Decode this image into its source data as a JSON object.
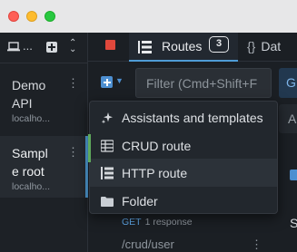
{
  "window": {
    "controls": [
      "close",
      "minimize",
      "zoom"
    ]
  },
  "sidebar": {
    "toolbar": {
      "env_icon": "laptop-icon",
      "ellipsis": "...",
      "add_icon": "plus-icon",
      "collapse_icon": "chevron-double-icon"
    },
    "environments": [
      {
        "name_line1": "Demo",
        "name_line2": "API",
        "host": "localho..."
      },
      {
        "name_line1": "Sampl",
        "name_line2": "e root",
        "host": "localho...",
        "selected": true
      }
    ],
    "kebab": "⋮"
  },
  "tabs": {
    "routes_label": "Routes",
    "routes_count": "3",
    "data_label": "Dat"
  },
  "route_toolbar": {
    "filter_placeholder": "Filter (Cmd+Shift+F",
    "partial_button": "G"
  },
  "add_menu": {
    "items": [
      {
        "label": "Assistants and templates",
        "icon": "sparkle-icon"
      },
      {
        "label": "CRUD route",
        "icon": "crud-grid-icon"
      },
      {
        "label": "HTTP route",
        "icon": "route-icon",
        "hovered": true
      },
      {
        "label": "Folder",
        "icon": "folder-icon"
      }
    ]
  },
  "routes_behind": {
    "method": "GET",
    "responses": "1 response",
    "next_path": "/crud/user"
  },
  "right_edge": {
    "a": "A",
    "s": "S"
  },
  "colors": {
    "accent": "#4d8fd1",
    "stop": "#e0483c",
    "crud": "#5fa85c",
    "selected_border": "#4f9cd6"
  }
}
